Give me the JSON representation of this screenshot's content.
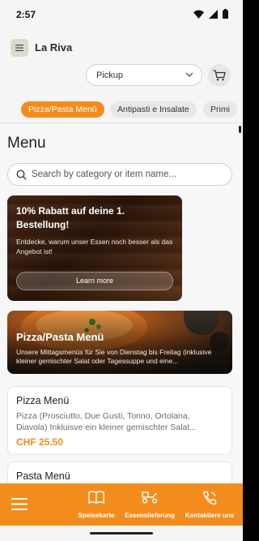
{
  "status_bar": {
    "time": "2:57"
  },
  "header": {
    "brand": "La Riva",
    "order_mode": "Pickup"
  },
  "tabs": [
    {
      "label": "Pizza/Pasta Menü",
      "active": true
    },
    {
      "label": "Antipasti e Insalate",
      "active": false
    },
    {
      "label": "Primi",
      "active": false
    }
  ],
  "main": {
    "heading": "Menu",
    "search_placeholder": "Search by category or item name...",
    "promo": {
      "title": "10% Rabatt auf deine 1. Bestellung!",
      "description": "Entdecke, warum unser Essen noch besser als das Angebot ist!",
      "button": "Learn more"
    },
    "category_banner": {
      "title": "Pizza/Pasta Menü",
      "description": "Unsere Mittagsmenüs für Sie von Dienstag bis Freitag (inklusive kleiner gemischter Salat oder Tagessuppe und eine..."
    },
    "items": [
      {
        "name": "Pizza Menü",
        "description_line1": "Pizza (Prosciutto, Due Gusti, Tonno, Ortolana,",
        "description_line2": "Diavola) Inkluisve ein kleiner gemischter Salat...",
        "price": "CHF 25.50"
      },
      {
        "name": "Pasta Menü"
      }
    ]
  },
  "bottom_nav": [
    {
      "label": "",
      "icon": "hamburger-icon"
    },
    {
      "label": "Speisekarte",
      "icon": "book-icon"
    },
    {
      "label": "Essenslieferung",
      "icon": "delivery-scooter-icon"
    },
    {
      "label": "Kontaktiere uns",
      "icon": "phone-icon"
    }
  ],
  "colors": {
    "accent": "#f28c1d",
    "background": "#f5f5f5"
  }
}
